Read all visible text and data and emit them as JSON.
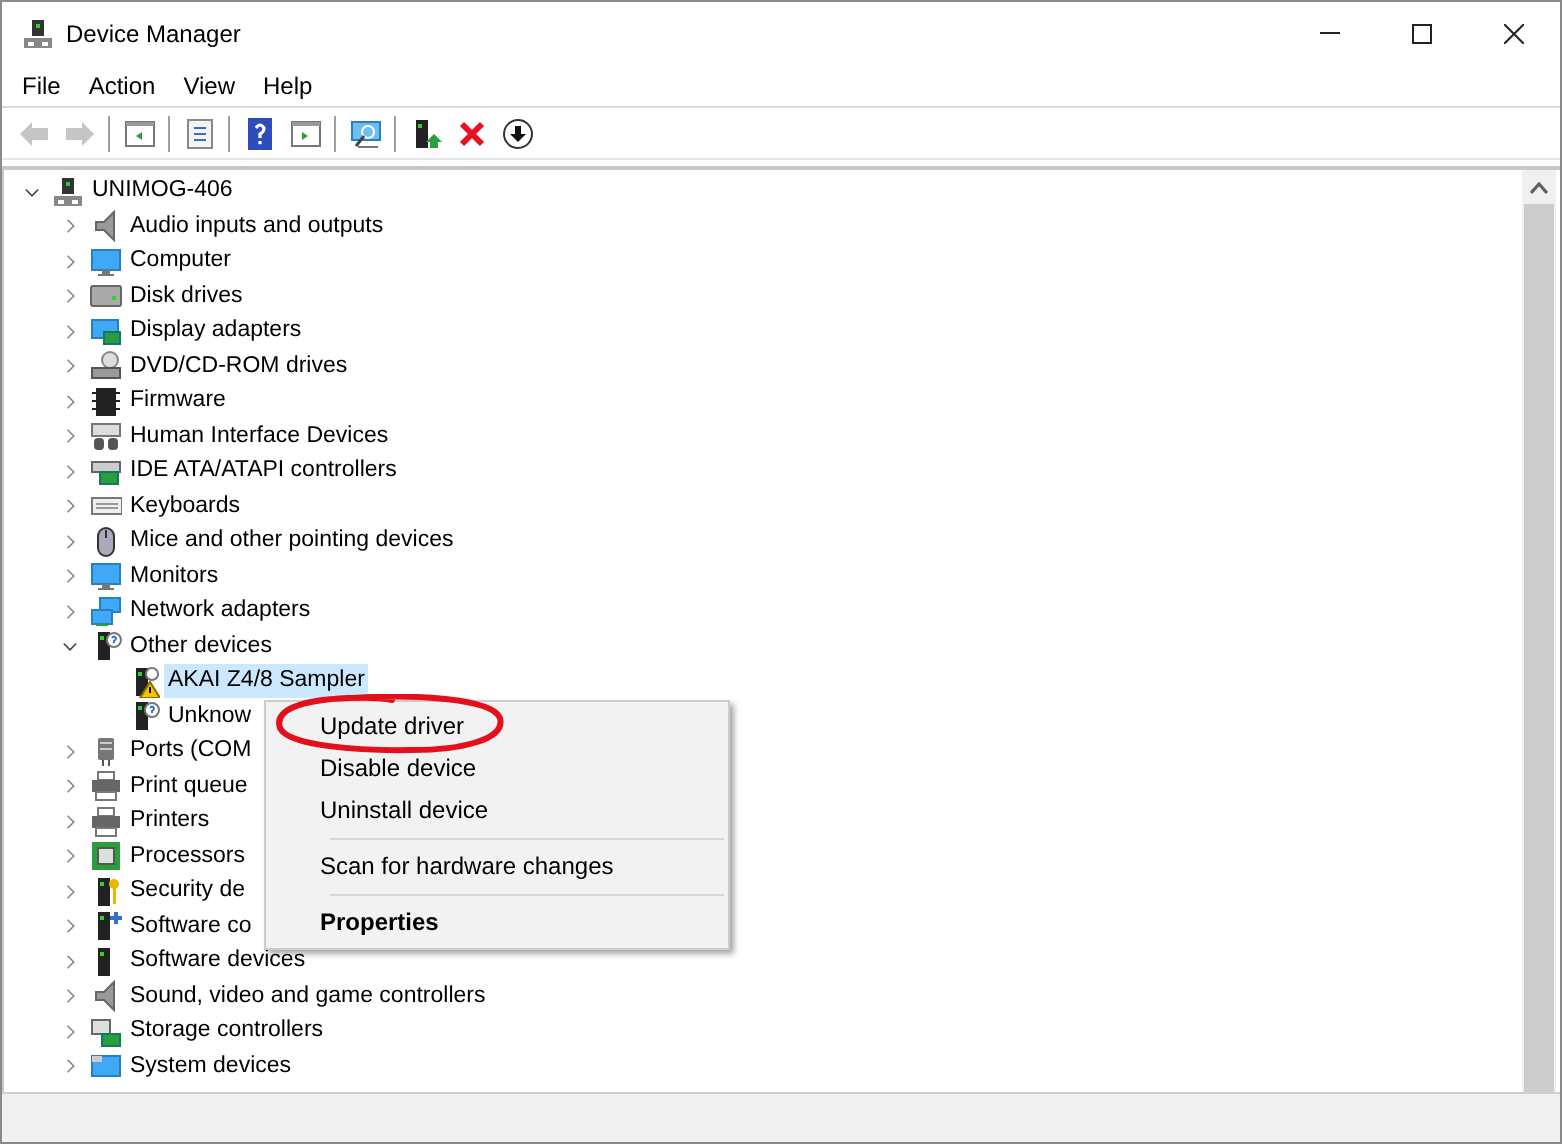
{
  "window": {
    "title": "Device Manager"
  },
  "menu_bar": [
    "File",
    "Action",
    "View",
    "Help"
  ],
  "toolbar": [
    {
      "kind": "back",
      "disabled": true
    },
    {
      "kind": "forward",
      "disabled": true
    },
    {
      "kind": "separator"
    },
    {
      "kind": "console-tree",
      "disabled": false
    },
    {
      "kind": "separator"
    },
    {
      "kind": "properties",
      "disabled": false
    },
    {
      "kind": "separator"
    },
    {
      "kind": "help",
      "disabled": false
    },
    {
      "kind": "action-pane",
      "disabled": false
    },
    {
      "kind": "separator"
    },
    {
      "kind": "scan",
      "disabled": false
    },
    {
      "kind": "separator"
    },
    {
      "kind": "update-driver",
      "disabled": false
    },
    {
      "kind": "uninstall",
      "disabled": false
    },
    {
      "kind": "disable",
      "disabled": false
    }
  ],
  "tree": {
    "label": "UNIMOG-406",
    "kind": "root",
    "expanded": true,
    "selected": false,
    "children": [
      {
        "label": "Audio inputs and outputs",
        "kind": "speaker",
        "expanded": false,
        "selected": false
      },
      {
        "label": "Computer",
        "kind": "monitor",
        "expanded": false,
        "selected": false
      },
      {
        "label": "Disk drives",
        "kind": "disk",
        "expanded": false,
        "selected": false
      },
      {
        "label": "Display adapters",
        "kind": "display",
        "expanded": false,
        "selected": false
      },
      {
        "label": "DVD/CD-ROM drives",
        "kind": "dvd",
        "expanded": false,
        "selected": false
      },
      {
        "label": "Firmware",
        "kind": "chip",
        "expanded": false,
        "selected": false
      },
      {
        "label": "Human Interface Devices",
        "kind": "hid",
        "expanded": false,
        "selected": false
      },
      {
        "label": "IDE ATA/ATAPI controllers",
        "kind": "card",
        "expanded": false,
        "selected": false
      },
      {
        "label": "Keyboards",
        "kind": "keyboard",
        "expanded": false,
        "selected": false
      },
      {
        "label": "Mice and other pointing devices",
        "kind": "mouse",
        "expanded": false,
        "selected": false
      },
      {
        "label": "Monitors",
        "kind": "monitor",
        "expanded": false,
        "selected": false
      },
      {
        "label": "Network adapters",
        "kind": "network",
        "expanded": false,
        "selected": false
      },
      {
        "label": "Other devices",
        "kind": "unknown",
        "expanded": true,
        "selected": false,
        "children": [
          {
            "label": "AKAI Z4/8 Sampler",
            "kind": "warning",
            "selected": true
          },
          {
            "label": "Unknow",
            "kind": "unknown",
            "selected": false
          }
        ]
      },
      {
        "label": "Ports (COM",
        "kind": "port",
        "expanded": false,
        "selected": false
      },
      {
        "label": "Print queue",
        "kind": "printer",
        "expanded": false,
        "selected": false
      },
      {
        "label": "Printers",
        "kind": "printer",
        "expanded": false,
        "selected": false
      },
      {
        "label": "Processors",
        "kind": "cpu",
        "expanded": false,
        "selected": false
      },
      {
        "label": "Security de",
        "kind": "security",
        "expanded": false,
        "selected": false
      },
      {
        "label": "Software co",
        "kind": "component",
        "expanded": false,
        "selected": false
      },
      {
        "label": "Software devices",
        "kind": "device",
        "expanded": false,
        "selected": false
      },
      {
        "label": "Sound, video and game controllers",
        "kind": "speaker",
        "expanded": false,
        "selected": false
      },
      {
        "label": "Storage controllers",
        "kind": "storage",
        "expanded": false,
        "selected": false
      },
      {
        "label": "System devices",
        "kind": "system",
        "expanded": false,
        "selected": false
      }
    ]
  },
  "context_menu": [
    {
      "kind": "item",
      "label": "Update driver",
      "default": false
    },
    {
      "kind": "item",
      "label": "Disable device",
      "default": false
    },
    {
      "kind": "item",
      "label": "Uninstall device",
      "default": false
    },
    {
      "kind": "separator"
    },
    {
      "kind": "item",
      "label": "Scan for hardware changes",
      "default": false
    },
    {
      "kind": "separator"
    },
    {
      "kind": "item",
      "label": "Properties",
      "default": true
    }
  ],
  "annotation": {
    "kind": "circle",
    "color": "#e3101c"
  }
}
